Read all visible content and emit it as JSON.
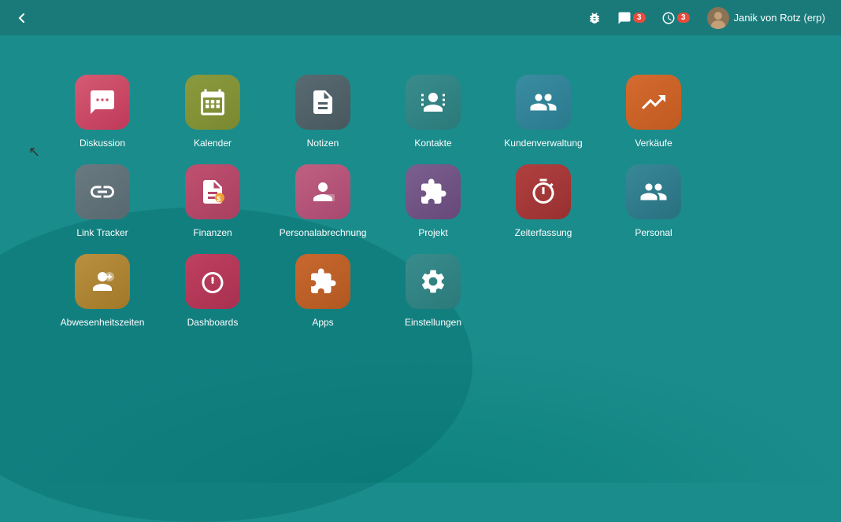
{
  "header": {
    "back_label": "←",
    "bug_icon": "🐛",
    "chat_icon": "💬",
    "chat_badge": "3",
    "clock_icon": "⏰",
    "clock_badge": "3",
    "user_name": "Janik von Rotz (erp)"
  },
  "apps": {
    "row1": [
      {
        "id": "diskussion",
        "label": "Diskussion",
        "color": "bg-pink"
      },
      {
        "id": "kalender",
        "label": "Kalender",
        "color": "bg-olive"
      },
      {
        "id": "notizen",
        "label": "Notizen",
        "color": "bg-gray-dark"
      },
      {
        "id": "kontakte",
        "label": "Kontakte",
        "color": "bg-teal-dark"
      },
      {
        "id": "kundenverwaltung",
        "label": "Kundenverwaltung",
        "color": "bg-teal-medium"
      },
      {
        "id": "verkaufe",
        "label": "Verkäufe",
        "color": "bg-orange"
      }
    ],
    "row2": [
      {
        "id": "link-tracker",
        "label": "Link Tracker",
        "color": "bg-gray-medium"
      },
      {
        "id": "finanzen",
        "label": "Finanzen",
        "color": "bg-pink-medium"
      },
      {
        "id": "personalabrechnung",
        "label": "Personalabrechnung",
        "color": "bg-pink-light"
      },
      {
        "id": "projekt",
        "label": "Projekt",
        "color": "bg-purple"
      },
      {
        "id": "zeiterfassung",
        "label": "Zeiterfassung",
        "color": "bg-red-dark"
      },
      {
        "id": "personal",
        "label": "Personal",
        "color": "bg-teal-app"
      }
    ],
    "row3": [
      {
        "id": "abwesenheitszeiten",
        "label": "Abwesenheitszeiten",
        "color": "bg-yellow"
      },
      {
        "id": "dashboards",
        "label": "Dashboards",
        "color": "bg-red-pink"
      },
      {
        "id": "apps",
        "label": "Apps",
        "color": "bg-orange-app"
      },
      {
        "id": "einstellungen",
        "label": "Einstellungen",
        "color": "bg-teal-dark"
      }
    ]
  }
}
